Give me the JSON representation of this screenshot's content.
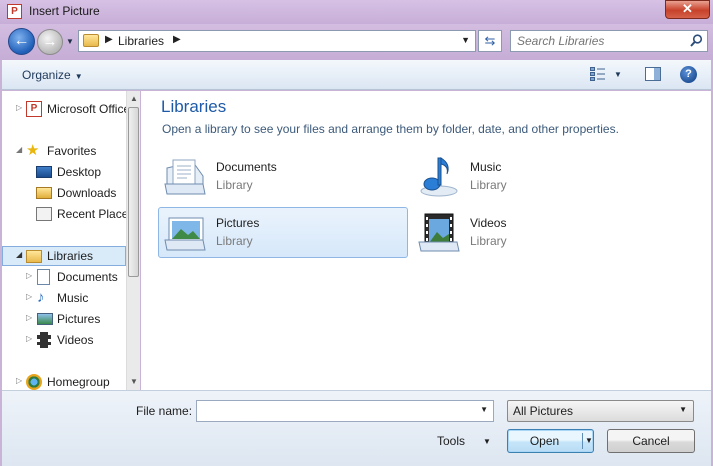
{
  "window": {
    "title": "Insert Picture",
    "close_glyph": "✕"
  },
  "nav": {
    "back_glyph": "←",
    "forward_glyph": "→",
    "address": {
      "crumb": "Libraries",
      "separator": "▶"
    },
    "search_placeholder": "Search Libraries"
  },
  "toolbar": {
    "organize": "Organize",
    "help_glyph": "?"
  },
  "navpane": {
    "items": [
      {
        "label": "Microsoft Office"
      },
      {
        "label": "Favorites"
      },
      {
        "label": "Desktop"
      },
      {
        "label": "Downloads"
      },
      {
        "label": "Recent Places"
      },
      {
        "label": "Libraries"
      },
      {
        "label": "Documents"
      },
      {
        "label": "Music"
      },
      {
        "label": "Pictures"
      },
      {
        "label": "Videos"
      },
      {
        "label": "Homegroup"
      }
    ]
  },
  "content": {
    "heading": "Libraries",
    "subtitle": "Open a library to see your files and arrange them by folder, date, and other properties.",
    "libraries": [
      {
        "name": "Documents",
        "type": "Library",
        "icon": "documents-library-icon"
      },
      {
        "name": "Music",
        "type": "Library",
        "icon": "music-library-icon"
      },
      {
        "name": "Pictures",
        "type": "Library",
        "icon": "pictures-library-icon",
        "selected": true
      },
      {
        "name": "Videos",
        "type": "Library",
        "icon": "videos-library-icon"
      }
    ]
  },
  "footer": {
    "file_name_label": "File name:",
    "file_name_value": "",
    "file_type": "All Pictures",
    "tools": "Tools",
    "open": "Open",
    "cancel": "Cancel"
  },
  "colors": {
    "accent": "#1e5aa8",
    "selection": "#d6e8fa",
    "title_bar": "#c9b3d6",
    "close_button": "#c7412a"
  }
}
